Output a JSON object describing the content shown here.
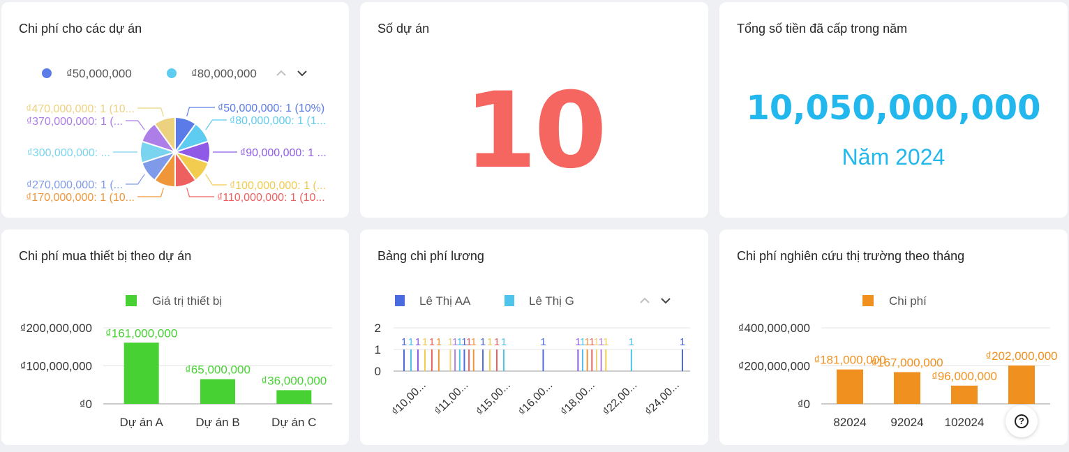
{
  "cards": {
    "pie_title": "Chi phí cho các dự án",
    "count_title": "Số dự án",
    "count_value": "10",
    "total_title": "Tổng số tiền đã cấp trong năm",
    "total_value": "10,050,000,000",
    "total_year": "Năm 2024",
    "equipment_title": "Chi phí mua thiết bị theo dự án",
    "salary_title": "Bảng chi phí lương",
    "research_title": "Chi phí nghiên cứu thị trường theo tháng"
  },
  "colors": {
    "count": "#f4665f",
    "total": "#22b8ee",
    "equipment": "#47d133",
    "research": "#f0901f"
  },
  "chart_data": [
    {
      "type": "pie",
      "title": "Chi phí cho các dự án",
      "legend_visible": [
        "₫50,000,000",
        "₫80,000,000"
      ],
      "legend_colors": [
        "#5b7be8",
        "#5ecbf0"
      ],
      "slices": [
        {
          "label": "₫50,000,000: 1 (10%)",
          "value": 1,
          "color": "#5b7be8"
        },
        {
          "label": "₫80,000,000: 1 (1...",
          "value": 1,
          "color": "#5ecbf0"
        },
        {
          "label": "₫90,000,000: 1 ...",
          "value": 1,
          "color": "#8f5ae6"
        },
        {
          "label": "₫100,000,000: 1 (...",
          "value": 1,
          "color": "#f2cc4e"
        },
        {
          "label": "₫110,000,000: 1 (10...",
          "value": 1,
          "color": "#ee5f5f"
        },
        {
          "label": "₫170,000,000: 1 (10...",
          "value": 1,
          "color": "#f0963a"
        },
        {
          "label": "₫270,000,000: 1 (...",
          "value": 1,
          "color": "#7f9ae9"
        },
        {
          "label": "₫300,000,000: ...",
          "value": 1,
          "color": "#7bd4ef"
        },
        {
          "label": "₫370,000,000: 1 (...",
          "value": 1,
          "color": "#ad7ee8"
        },
        {
          "label": "₫470,000,000: 1 (10...",
          "value": 1,
          "color": "#ecd27e"
        }
      ]
    },
    {
      "type": "bar",
      "title": "Chi phí mua thiết bị theo dự án",
      "categories": [
        "Dự án A",
        "Dự án B",
        "Dự án C"
      ],
      "series": [
        {
          "name": "Giá trị thiết bị",
          "values": [
            161000000,
            65000000,
            36000000
          ],
          "color": "#47d133"
        }
      ],
      "data_labels": [
        "₫161,000,000",
        "₫65,000,000",
        "₫36,000,000"
      ],
      "ytick_labels": [
        "₫200,000,000",
        "₫100,000,000",
        "₫0"
      ],
      "ylim": [
        0,
        200000000
      ]
    },
    {
      "type": "bar",
      "title": "Bảng chi phí lương",
      "legend": [
        {
          "name": "Lê Thị AA",
          "color": "#4a6ae0"
        },
        {
          "name": "Lê Thị G",
          "color": "#4ec3ec"
        }
      ],
      "ytick_labels": [
        "2",
        "1",
        "0"
      ],
      "ylim": [
        0,
        2
      ],
      "xtick_labels": [
        "₫10,00...",
        "₫11,00...",
        "₫15,00...",
        "₫16,00...",
        "₫18,00...",
        "₫22,00...",
        "₫24,00..."
      ],
      "bars": [
        {
          "x": 0.0,
          "value": 1,
          "color": "#4a6ae0"
        },
        {
          "x": 0.15,
          "value": 1,
          "color": "#4ec3ec"
        },
        {
          "x": 0.3,
          "value": 1,
          "color": "#8f5ae6"
        },
        {
          "x": 0.45,
          "value": 1,
          "color": "#f2cc4e"
        },
        {
          "x": 0.6,
          "value": 1,
          "color": "#ee5f5f"
        },
        {
          "x": 0.75,
          "value": 1,
          "color": "#f0963a"
        },
        {
          "x": 1.0,
          "value": 1,
          "color": "#ecd27e"
        },
        {
          "x": 1.1,
          "value": 1,
          "color": "#ad7ee8"
        },
        {
          "x": 1.2,
          "value": 1,
          "color": "#4ec3ec"
        },
        {
          "x": 1.3,
          "value": 1,
          "color": "#4a6ae0"
        },
        {
          "x": 1.4,
          "value": 1,
          "color": "#ee5f5f"
        },
        {
          "x": 1.5,
          "value": 1,
          "color": "#f0963a"
        },
        {
          "x": 1.7,
          "value": 1,
          "color": "#4a6ae0"
        },
        {
          "x": 1.85,
          "value": 1,
          "color": "#f2cc4e"
        },
        {
          "x": 2.0,
          "value": 1,
          "color": "#ee5f5f"
        },
        {
          "x": 2.15,
          "value": 1,
          "color": "#4ec3ec"
        },
        {
          "x": 3.0,
          "value": 1,
          "color": "#4a6ae0"
        },
        {
          "x": 3.75,
          "value": 1,
          "color": "#8f5ae6"
        },
        {
          "x": 3.85,
          "value": 1,
          "color": "#4ec3ec"
        },
        {
          "x": 3.95,
          "value": 1,
          "color": "#f0963a"
        },
        {
          "x": 4.05,
          "value": 1,
          "color": "#ee5f5f"
        },
        {
          "x": 4.15,
          "value": 1,
          "color": "#ecd27e"
        },
        {
          "x": 4.25,
          "value": 1,
          "color": "#ad7ee8"
        },
        {
          "x": 4.35,
          "value": 1,
          "color": "#f2cc4e"
        },
        {
          "x": 4.9,
          "value": 1,
          "color": "#4ec3ec"
        },
        {
          "x": 6.0,
          "value": 1,
          "color": "#4a6ae0"
        }
      ]
    },
    {
      "type": "bar",
      "title": "Chi phí nghiên cứu thị trường theo tháng",
      "categories": [
        "82024",
        "92024",
        "102024",
        "112024"
      ],
      "categories_display": [
        "82024",
        "92024",
        "102024",
        "1   4"
      ],
      "series": [
        {
          "name": "Chi phí",
          "values": [
            181000000,
            167000000,
            96000000,
            202000000
          ],
          "color": "#f0901f"
        }
      ],
      "data_labels": [
        "₫181,000,000",
        "₫167,000,000",
        "₫96,000,000",
        "₫202,000,000"
      ],
      "ytick_labels": [
        "₫400,000,000",
        "₫200,000,000",
        "₫0"
      ],
      "ylim": [
        0,
        400000000
      ]
    }
  ],
  "help": {
    "label": "?"
  }
}
